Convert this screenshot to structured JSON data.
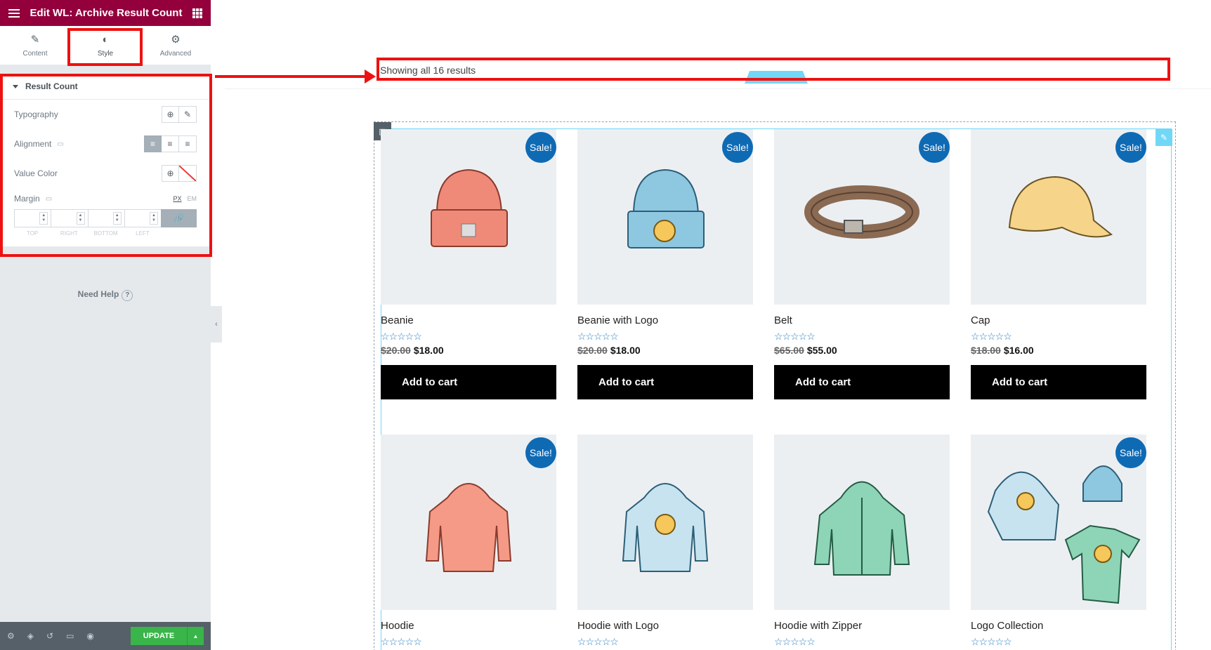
{
  "panel": {
    "title": "Edit WL: Archive Result Count",
    "tabs": [
      {
        "label": "Content"
      },
      {
        "label": "Style"
      },
      {
        "label": "Advanced"
      }
    ],
    "section_title": "Result Count",
    "controls": {
      "typography": "Typography",
      "alignment": "Alignment",
      "value_color": "Value Color",
      "margin": "Margin"
    },
    "units": [
      "PX",
      "EM"
    ],
    "margin_labels": [
      "TOP",
      "RIGHT",
      "BOTTOM",
      "LEFT"
    ],
    "need_help": "Need Help",
    "update": "UPDATE"
  },
  "canvas": {
    "result_count": "Showing all 16 results",
    "products": [
      {
        "name": "Beanie",
        "old_price": "$20.00",
        "price": "$18.00",
        "sale": "Sale!",
        "cart": "Add to cart"
      },
      {
        "name": "Beanie with Logo",
        "old_price": "$20.00",
        "price": "$18.00",
        "sale": "Sale!",
        "cart": "Add to cart"
      },
      {
        "name": "Belt",
        "old_price": "$65.00",
        "price": "$55.00",
        "sale": "Sale!",
        "cart": "Add to cart"
      },
      {
        "name": "Cap",
        "old_price": "$18.00",
        "price": "$16.00",
        "sale": "Sale!",
        "cart": "Add to cart"
      },
      {
        "name": "Hoodie",
        "sale": "Sale!"
      },
      {
        "name": "Hoodie with Logo"
      },
      {
        "name": "Hoodie with Zipper"
      },
      {
        "name": "Logo Collection",
        "sale": "Sale!"
      }
    ],
    "stars": "☆☆☆☆☆"
  },
  "colors": {
    "header": "#93003c",
    "sale_badge": "#0f6ab4",
    "highlight": "#ee1111",
    "update_button": "#39b54a"
  }
}
